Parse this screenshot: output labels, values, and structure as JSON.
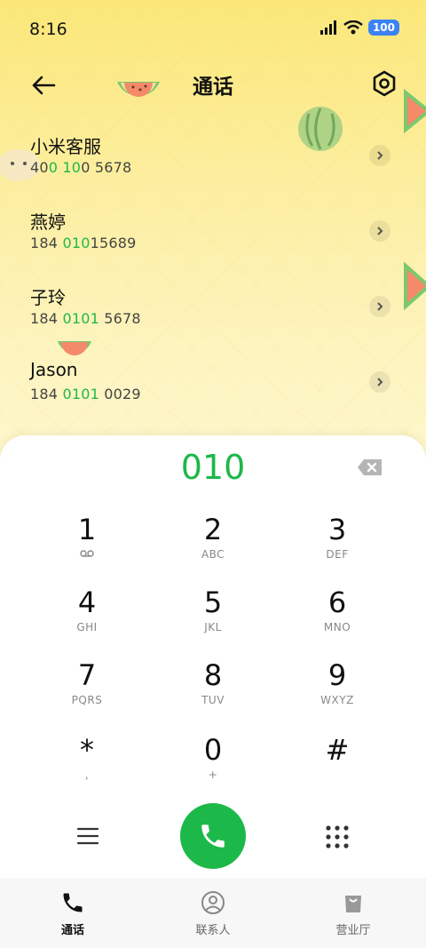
{
  "status_bar": {
    "time": "8:16",
    "battery": "100"
  },
  "header": {
    "title": "通话"
  },
  "calls": [
    {
      "name": "小米客服",
      "pre": "400 ",
      "hl": "010",
      "post": "0 5678",
      "num_parts": [
        "40",
        "0 10",
        "0 5678"
      ]
    },
    {
      "name": "燕婷",
      "parts": [
        "184 ",
        "010",
        "15689"
      ]
    },
    {
      "name": "子玲",
      "parts": [
        "184 ",
        "0101",
        " 5678"
      ]
    },
    {
      "name": "Jason",
      "parts": [
        "184 ",
        "0101",
        " 0029"
      ]
    }
  ],
  "dialer": {
    "dialed": "010",
    "keys": [
      {
        "digit": "1",
        "letters": ""
      },
      {
        "digit": "2",
        "letters": "ABC"
      },
      {
        "digit": "3",
        "letters": "DEF"
      },
      {
        "digit": "4",
        "letters": "GHI"
      },
      {
        "digit": "5",
        "letters": "JKL"
      },
      {
        "digit": "6",
        "letters": "MNO"
      },
      {
        "digit": "7",
        "letters": "PQRS"
      },
      {
        "digit": "8",
        "letters": "TUV"
      },
      {
        "digit": "9",
        "letters": "WXYZ"
      },
      {
        "digit": "*",
        "letters": ","
      },
      {
        "digit": "0",
        "letters": "+"
      },
      {
        "digit": "#",
        "letters": ""
      }
    ]
  },
  "bottom_nav": [
    {
      "label": "通话",
      "icon": "phone-icon",
      "active": true
    },
    {
      "label": "联系人",
      "icon": "contacts-icon",
      "active": false
    },
    {
      "label": "营业厅",
      "icon": "store-bag-icon",
      "active": false
    }
  ],
  "accent_color": "#1db84a"
}
